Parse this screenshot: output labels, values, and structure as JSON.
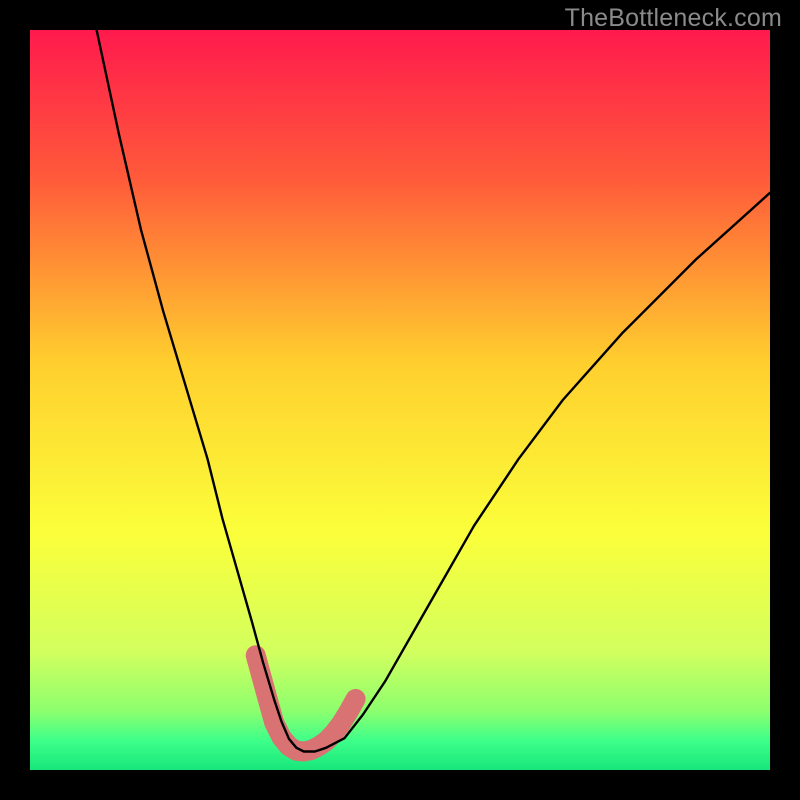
{
  "watermark": "TheBottleneck.com",
  "chart_data": {
    "type": "line",
    "title": "",
    "xlabel": "",
    "ylabel": "",
    "xlim": [
      0,
      100
    ],
    "ylim": [
      0,
      100
    ],
    "grid": false,
    "legend": false,
    "gradient_stops": [
      {
        "pos": 0.0,
        "color": "#ff1a4d"
      },
      {
        "pos": 0.2,
        "color": "#ff5a3a"
      },
      {
        "pos": 0.45,
        "color": "#ffcf2e"
      },
      {
        "pos": 0.68,
        "color": "#fbff3a"
      },
      {
        "pos": 0.84,
        "color": "#d2ff5e"
      },
      {
        "pos": 0.92,
        "color": "#8dff6e"
      },
      {
        "pos": 0.96,
        "color": "#3eff8a"
      },
      {
        "pos": 1.0,
        "color": "#17e67a"
      }
    ],
    "series": [
      {
        "name": "bottleneck-curve",
        "stroke": "#000000",
        "x": [
          9,
          12,
          15,
          18,
          21,
          24,
          26,
          28,
          30,
          31.5,
          33,
          34,
          35,
          36,
          37,
          38.5,
          40,
          42.5,
          45,
          48,
          52,
          56,
          60,
          66,
          72,
          80,
          90,
          100
        ],
        "y": [
          100,
          86,
          73,
          62,
          52,
          42,
          34,
          27,
          20,
          14.5,
          9.5,
          6.5,
          4.2,
          3.0,
          2.5,
          2.5,
          3.0,
          4.3,
          7.5,
          12,
          19,
          26,
          33,
          42,
          50,
          59,
          69,
          78
        ]
      },
      {
        "name": "highlight-band",
        "stroke": "#d97272",
        "stroke_width": 20,
        "x": [
          30.5,
          32,
          33,
          34,
          35,
          36,
          37,
          38,
          39,
          40,
          41,
          42,
          43,
          44
        ],
        "y": [
          15.5,
          10,
          6.4,
          4.4,
          3.2,
          2.6,
          2.5,
          2.7,
          3.2,
          3.9,
          4.9,
          6.2,
          7.8,
          9.6
        ]
      }
    ],
    "highlight_dot": {
      "x": 30.5,
      "y": 15.5,
      "r": 9,
      "color": "#d97272"
    }
  }
}
